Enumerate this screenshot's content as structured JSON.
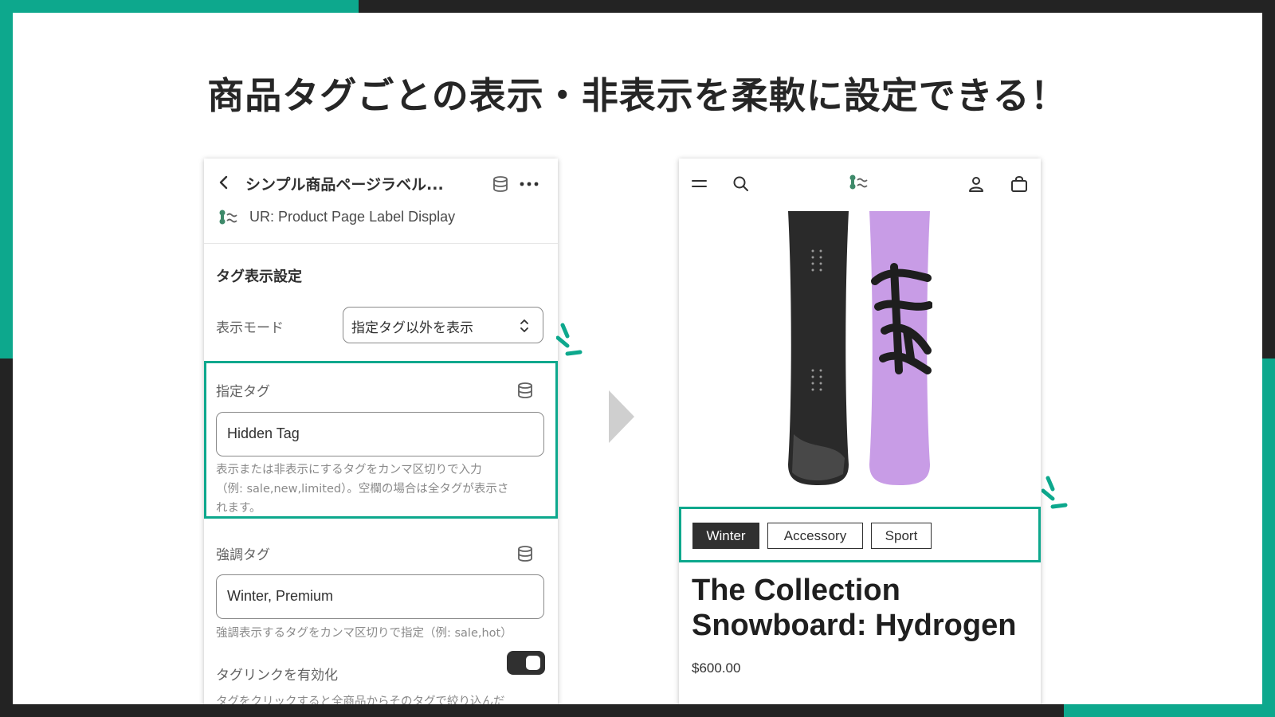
{
  "headline": "商品タグごとの表示・非表示を柔軟に設定できる！",
  "colors": {
    "accent": "#0da88d",
    "frame": "#232323",
    "board_purple": "#c89ce6"
  },
  "settings_panel": {
    "title": "シンプル商品ページラベル...",
    "app_name": "UR: Product Page Label Display",
    "section_title": "タグ表示設定",
    "display_mode": {
      "label": "表示モード",
      "value": "指定タグ以外を表示"
    },
    "specified_tags": {
      "label": "指定タグ",
      "value": "Hidden Tag",
      "help_1": "表示または非表示にするタグをカンマ区切りで入力",
      "help_2": "（例: sale,new,limited）。空欄の場合は全タグが表示さ",
      "help_3": "れます。"
    },
    "emphasis_tags": {
      "label": "強調タグ",
      "value": "Winter, Premium",
      "help": "強調表示するタグをカンマ区切りで指定（例: sale,hot）"
    },
    "tag_link": {
      "label": "タグリンクを有効化",
      "enabled": true,
      "help": "タグをクリックすると全商品からそのタグで絞り込んだ"
    }
  },
  "storefront": {
    "icons": [
      "menu-icon",
      "search-icon",
      "logo-icon",
      "account-icon",
      "cart-icon"
    ],
    "tags": [
      {
        "label": "Winter",
        "emphasized": true
      },
      {
        "label": "Accessory",
        "emphasized": false
      },
      {
        "label": "Sport",
        "emphasized": false
      }
    ],
    "product_title_line1": "The Collection",
    "product_title_line2": "Snowboard: Hydrogen",
    "price": "$600.00"
  }
}
